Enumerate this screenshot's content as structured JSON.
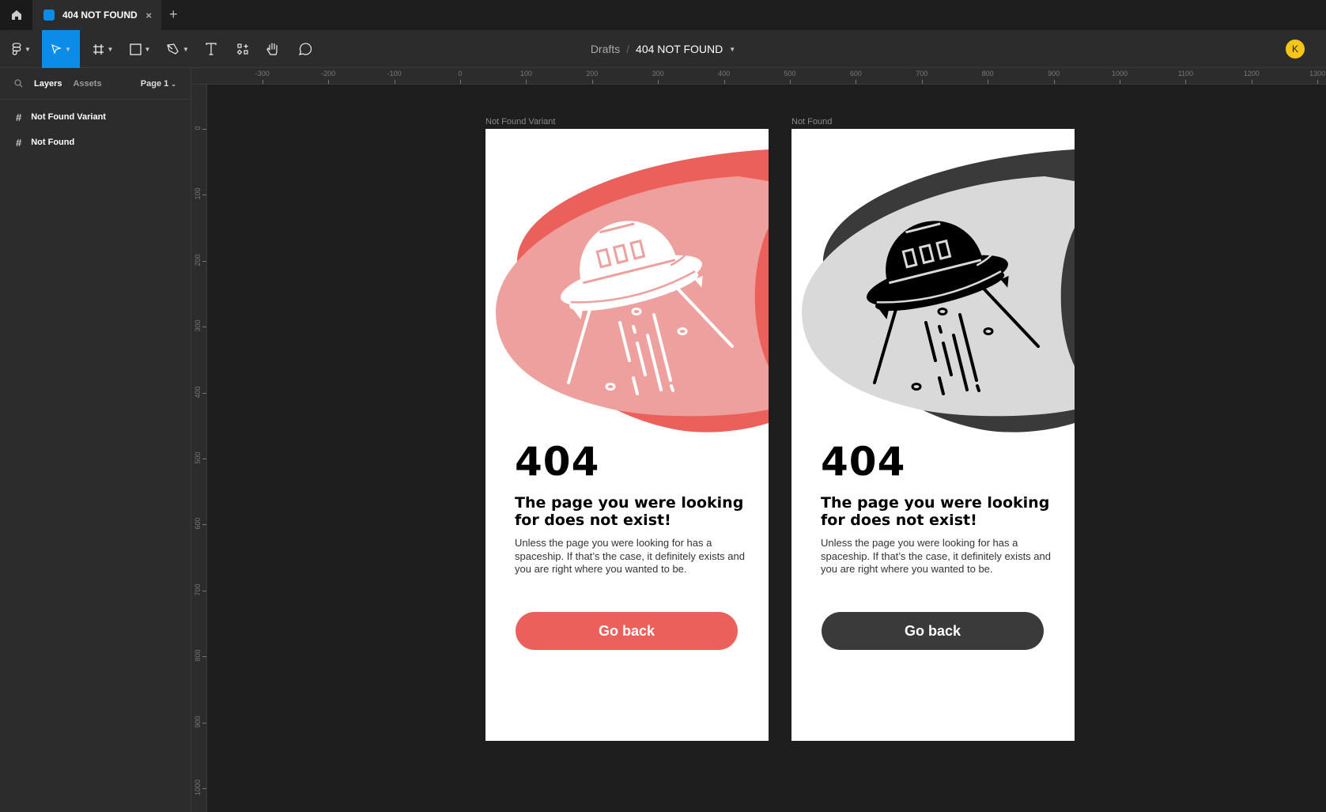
{
  "tab": {
    "title": "404 NOT FOUND",
    "close": "×",
    "new_tab": "+"
  },
  "breadcrumb": {
    "folder": "Drafts",
    "separator": "/",
    "file": "404 NOT FOUND"
  },
  "user": {
    "initial": "K"
  },
  "panel": {
    "layers_tab": "Layers",
    "assets_tab": "Assets",
    "page": "Page 1",
    "layers": [
      {
        "label": "Not Found Variant"
      },
      {
        "label": "Not Found"
      }
    ]
  },
  "rulers": {
    "horizontal": [
      -300,
      -200,
      -100,
      0,
      100,
      200,
      300,
      400,
      500,
      600,
      700,
      800,
      900,
      1000,
      1100,
      1200,
      1300
    ],
    "vertical": [
      0,
      100,
      200,
      300,
      400,
      500,
      600,
      700,
      800,
      900,
      1000
    ]
  },
  "frames": [
    {
      "name": "Not Found Variant",
      "code": "404",
      "heading": "The page you were looking for does not exist!",
      "body": "Unless the page you were looking for has a spaceship. If that’s the case, it definitely exists and you are right where you wanted to be.",
      "button": "Go back",
      "colors": {
        "dark": "#EB605A",
        "light": "#EDA09D",
        "ufo": "#FFFFFF",
        "button": "#EB605A"
      }
    },
    {
      "name": "Not Found",
      "code": "404",
      "heading": "The page you were looking for does not exist!",
      "body": "Unless the page you were looking for has a spaceship. If that’s the case, it definitely exists and you are right where you wanted to be.",
      "button": "Go back",
      "colors": {
        "dark": "#3B3A3A",
        "light": "#D9D9D9",
        "ufo": "#000000",
        "button": "#3B3A3A"
      }
    }
  ]
}
